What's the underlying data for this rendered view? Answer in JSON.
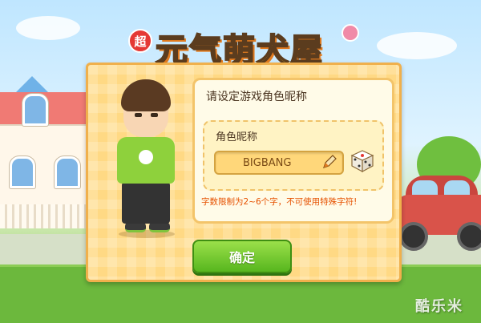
{
  "logo": {
    "badge": "超",
    "title": "元气萌犬屋"
  },
  "dialog": {
    "prompt": "请设定游戏角色昵称",
    "field_label": "角色昵称",
    "nickname_value": "BIGBANG",
    "rule_text": "字数限制为2~6个字，不可使用特殊字符!",
    "confirm_label": "确定"
  },
  "icons": {
    "edit": "pencil-icon",
    "random": "dice-icon",
    "paw": "paw-icon"
  },
  "watermark": "酷乐米",
  "colors": {
    "confirm": "#6cc42c",
    "panel": "#ffd984",
    "rule": "#e65100",
    "title": "#ffd93b"
  }
}
